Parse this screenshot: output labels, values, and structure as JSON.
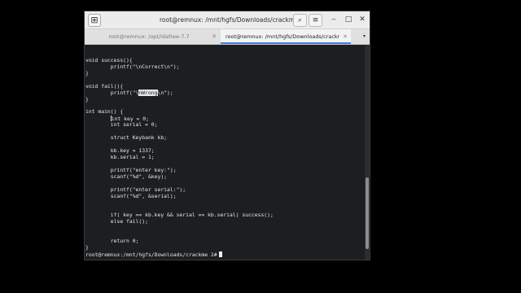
{
  "window": {
    "title": "root@remnux: /mnt/hgfs/Downloads/crackme 2",
    "new_tab_icon": "⊞",
    "search_icon": "⌕",
    "menu_icon": "≡",
    "minimize_icon": "‒",
    "maximize_icon": "□",
    "close_icon": "✕"
  },
  "tabs": [
    {
      "label": "root@remnux: /opt/idafree-7.7",
      "active": false,
      "close": "✕"
    },
    {
      "label": "root@remnux: /mnt/hgfs/Downloads/crackm",
      "active": true,
      "close": "✕"
    }
  ],
  "tab_menu_icon": "▾",
  "terminal": {
    "lines": [
      "",
      "void success(){",
      "        printf(\"\\nCorrect\\n\");",
      "}",
      "",
      "void fail(){",
      "        printf(\"\\nWrong\\n\");",
      "}",
      "",
      "int main() {",
      "        int key = 0;",
      "        int serial = 0;",
      "",
      "        struct Keybank kb;",
      "",
      "        kb.key = 1337;",
      "        kb.serial = 1;",
      "",
      "        printf(\"enter key:\");",
      "        scanf(\"%d\", &key);",
      "",
      "        printf(\"enter serial:\");",
      "        scanf(\"%d\", &serial);",
      "",
      "",
      "        if( key == kb.key && serial == kb.serial) success();",
      "        else fail();",
      "",
      "",
      "        return 0;",
      "}"
    ],
    "selection_line_index": 6,
    "selection_text": "nWrong",
    "caret_line_index": 10,
    "prompt": "root@remnux:/mnt/hgfs/Downloads/crackme 2# "
  }
}
